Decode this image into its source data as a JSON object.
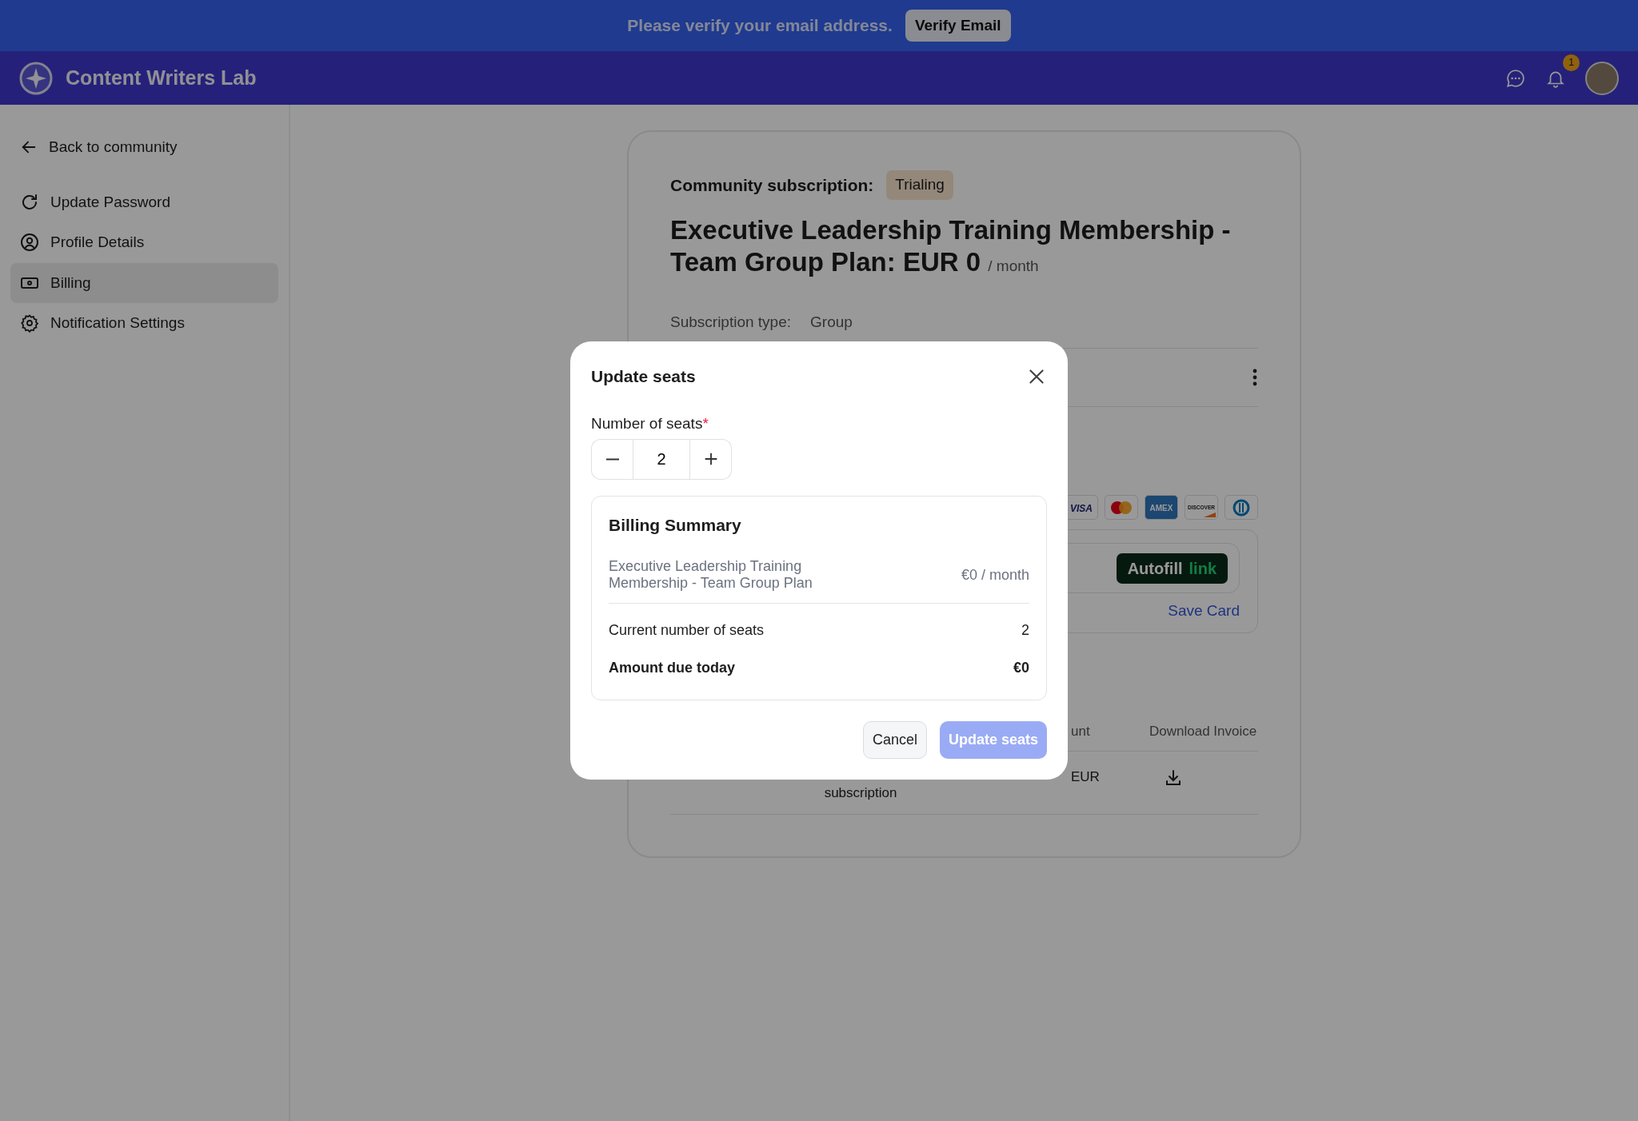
{
  "banner": {
    "message": "Please verify your email address.",
    "button": "Verify Email"
  },
  "navbar": {
    "title": "Content Writers Lab",
    "notification_count": "1"
  },
  "sidebar": {
    "back_link": "Back to community",
    "items": [
      {
        "label": "Update Password",
        "kind": "password",
        "selected": false
      },
      {
        "label": "Profile Details",
        "kind": "profile",
        "selected": false
      },
      {
        "label": "Billing",
        "kind": "billing",
        "selected": true
      },
      {
        "label": "Notification Settings",
        "kind": "settings",
        "selected": false
      }
    ]
  },
  "subscription": {
    "label": "Community subscription:",
    "status": "Trialing",
    "plan_title": "Executive Leadership Training Membership - Team Group Plan: EUR 0",
    "period": "/ month",
    "type_label": "Subscription type:",
    "type_value": "Group"
  },
  "payment": {
    "card_brands": [
      {
        "kind": "visa",
        "label": "VISA"
      },
      {
        "kind": "mastercard"
      },
      {
        "kind": "amex",
        "label": "AMEX"
      },
      {
        "kind": "discover",
        "label": "DISCOVER"
      },
      {
        "kind": "diners"
      }
    ],
    "autofill_label": "Autofill",
    "autofill_brand": "link",
    "save_card": "Save Card"
  },
  "invoices": {
    "columns": [
      "unt",
      "Download Invoice"
    ],
    "rows": [
      {
        "column_2": "subscription",
        "column_4": "EUR"
      }
    ]
  },
  "modal": {
    "title": "Update seats",
    "seats_label": "Number of seats",
    "required_mark": "*",
    "seats_value": "2",
    "summary": {
      "title": "Billing Summary",
      "plan": "Executive Leadership Training Membership - Team Group Plan",
      "plan_price": "€0 / month",
      "rows": [
        {
          "label": "Current number of seats",
          "value": "2",
          "kind": "plain"
        },
        {
          "label": "Amount due today",
          "value": "€0",
          "kind": "total"
        }
      ]
    },
    "buttons": [
      {
        "label": "Cancel",
        "kind": "secondary"
      },
      {
        "label": "Update seats",
        "kind": "primary",
        "disabled": true
      }
    ]
  }
}
